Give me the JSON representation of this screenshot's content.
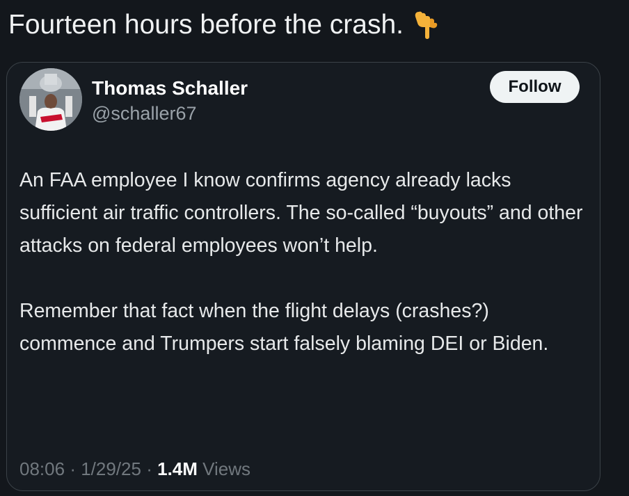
{
  "headline": {
    "text": "Fourteen hours before the crash.",
    "emoji_icon": "backhand-index-pointing-down-icon"
  },
  "tweet": {
    "author": {
      "name": "Thomas Schaller",
      "handle": "@schaller67"
    },
    "follow_label": "Follow",
    "body": [
      "An FAA employee I know confirms agency already lacks sufficient air traffic controllers. The so-called “buyouts” and other attacks on federal employees won’t help.",
      "Remember that fact when the flight delays (crashes?) commence and Trumpers start falsely blaming DEI or Biden."
    ],
    "time": "08:06",
    "separator": "·",
    "date": "1/29/25",
    "views_count": "1.4M",
    "views_label": "Views"
  },
  "colors": {
    "background": "#13171c",
    "card": "#161b21",
    "border": "#3b4248",
    "muted": "#71787e",
    "follow_bg": "#eff3f4"
  }
}
